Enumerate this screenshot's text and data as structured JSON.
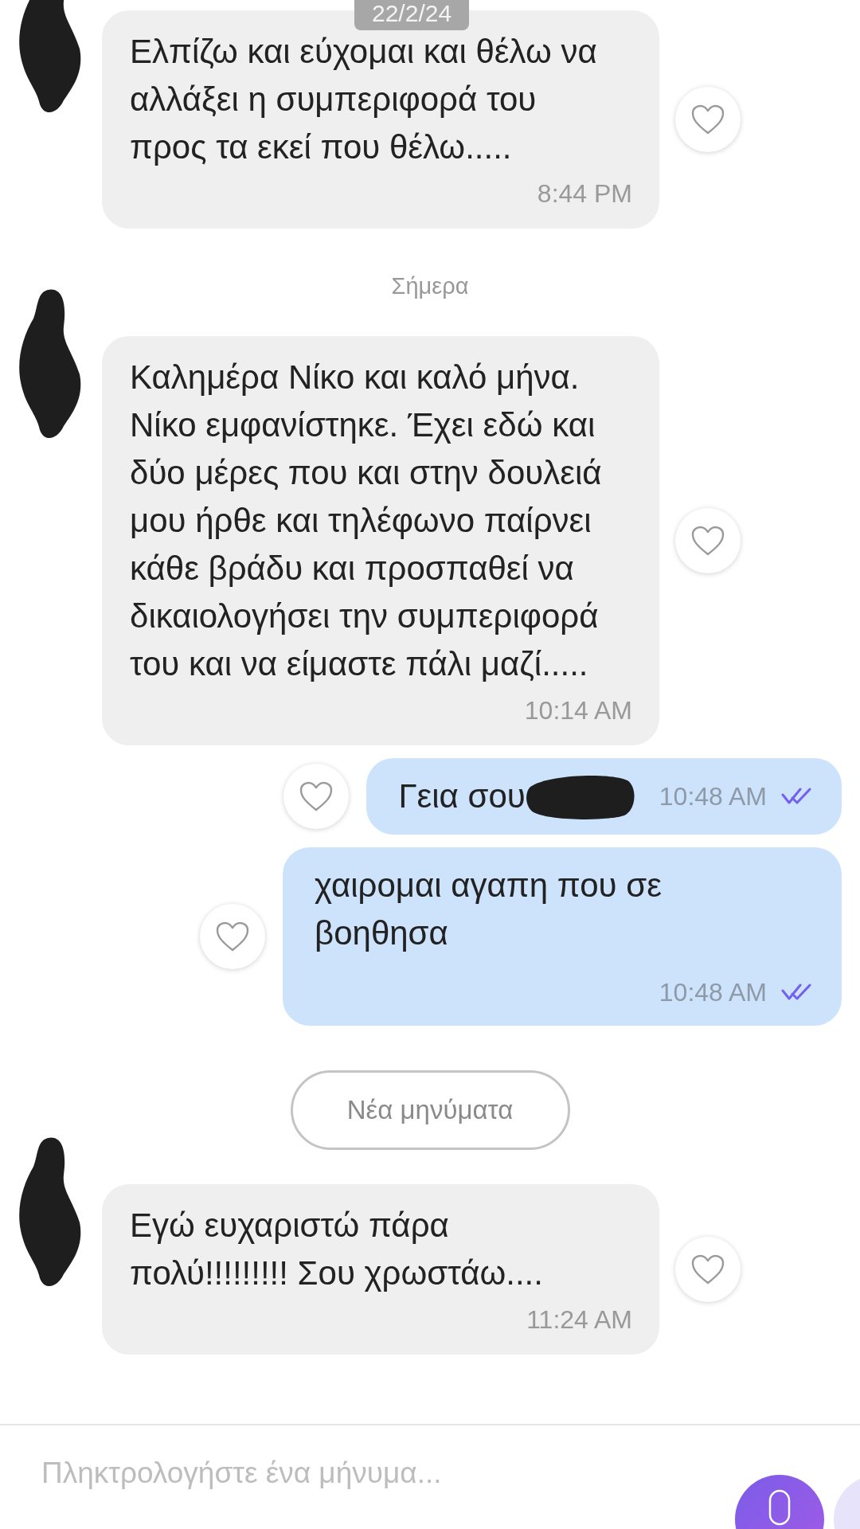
{
  "date_badge": "22/2/24",
  "messages": [
    {
      "kind": "incoming",
      "text": "Ελπίζω και εύχομαι και θέλω να αλλάξει η συμπεριφορά του προς τα εκεί που θέλω.....",
      "time": "8:44 PM"
    },
    {
      "kind": "date",
      "text": "Σήμερα"
    },
    {
      "kind": "incoming",
      "text": "Καλημέρα Νίκο και καλό μήνα. Νίκο εμφανίστηκε. Έχει εδώ και δύο μέρες που και στην δουλειά μου ήρθε και τηλέφωνο παίρνει κάθε βράδυ και προσπαθεί να δικαιολογήσει την συμπεριφορά του και να είμαστε πάλι μαζί.....",
      "time": "10:14 AM"
    },
    {
      "kind": "outgoing",
      "text": "Γεια σου",
      "redacted": true,
      "time": "10:48 AM",
      "read": true
    },
    {
      "kind": "outgoing",
      "text": "χαιρομαι αγαπη που σε βοηθησα",
      "redacted": false,
      "time": "10:48 AM",
      "read": true
    },
    {
      "kind": "new_messages",
      "text": "Νέα μηνύματα"
    },
    {
      "kind": "incoming",
      "text": "Εγώ ευχαριστώ πάρα πολύ!!!!!!!!! Σου χρωστάω....",
      "time": "11:24 AM"
    }
  ],
  "composer": {
    "placeholder": "Πληκτρολογήστε ένα μήνυμα..."
  }
}
